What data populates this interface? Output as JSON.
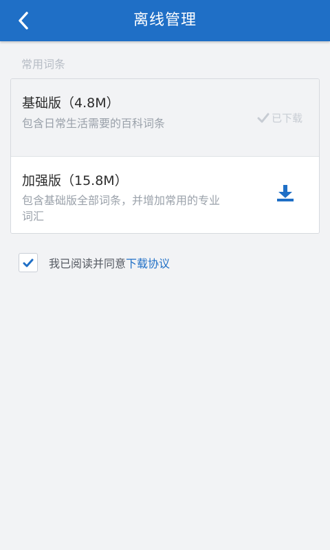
{
  "app_bar": {
    "title": "离线管理",
    "back_icon": "chevron-left-icon",
    "color": "#1f6fc6"
  },
  "section": {
    "label": "常用词条"
  },
  "packages": [
    {
      "title": "基础版（4.8M）",
      "description": "包含日常生活需要的百科词条",
      "status_label": "已下载",
      "status_icon": "checkmark-icon"
    },
    {
      "title": "加强版（15.8M）",
      "description": "包含基础版全部词条，并增加常用的专业词汇",
      "action_icon": "download-icon"
    }
  ],
  "agreement": {
    "checked": true,
    "text": "我已阅读并同意",
    "link_text": "下载协议"
  },
  "colors": {
    "accent": "#1f6fc6",
    "background": "#f2f3f5"
  }
}
